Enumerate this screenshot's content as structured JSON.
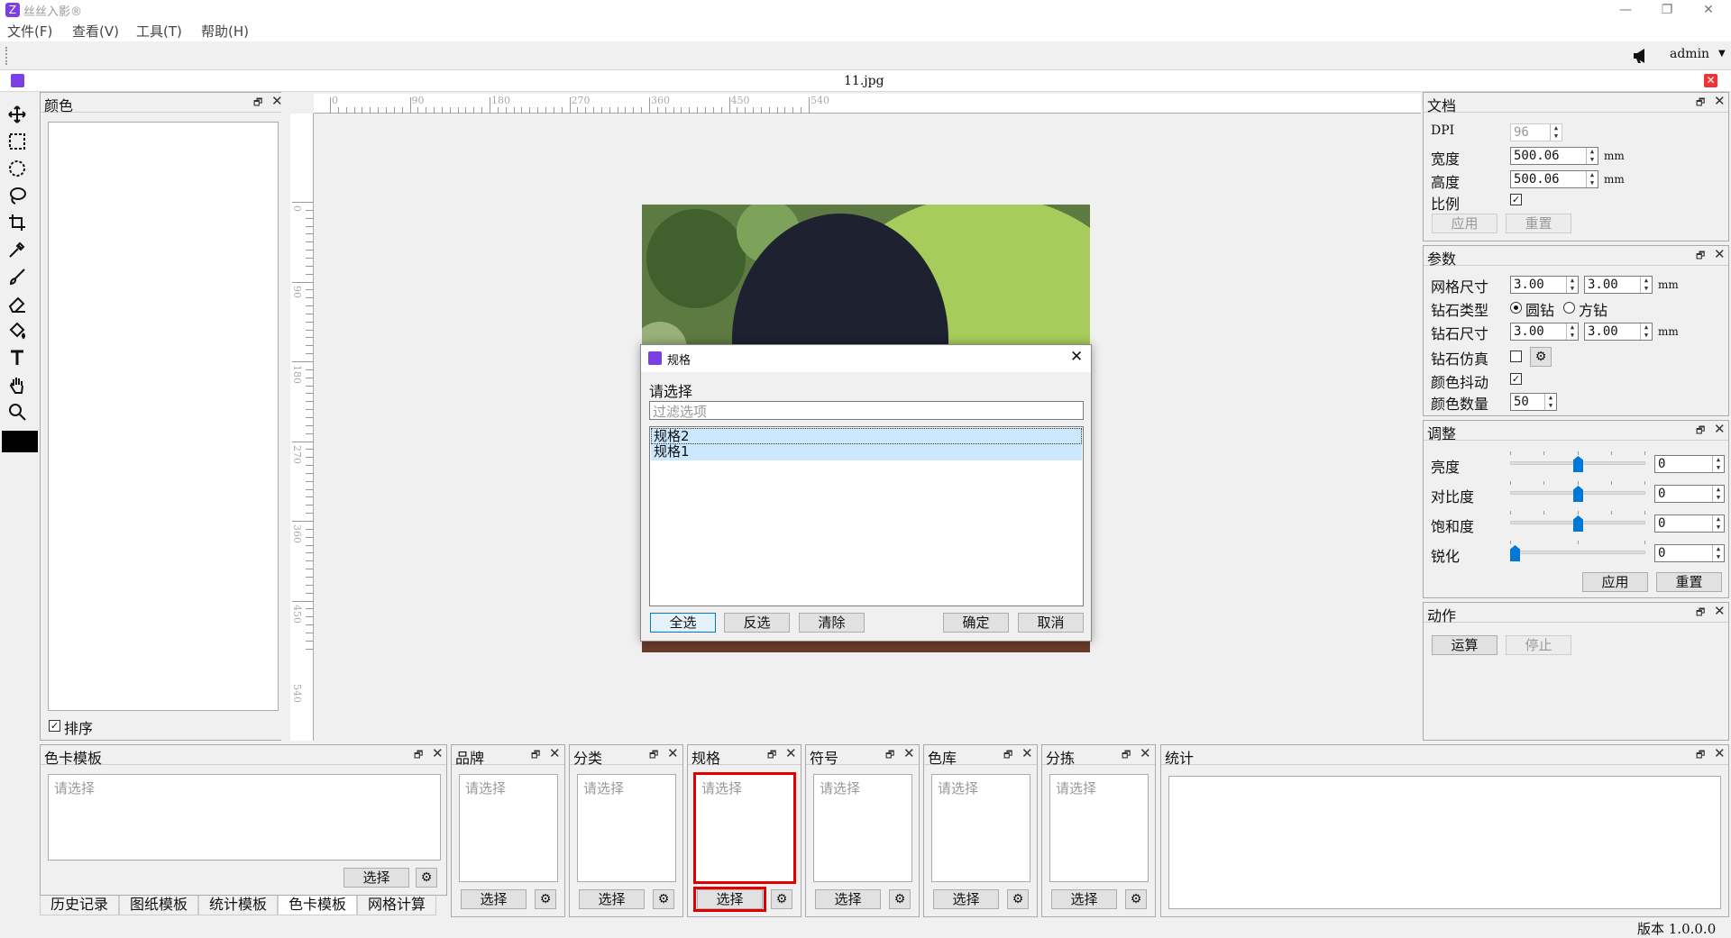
{
  "app": {
    "title": "丝丝入影®"
  },
  "menu": [
    "文件(F)",
    "查看(V)",
    "工具(T)",
    "帮助(H)"
  ],
  "toolbar": {
    "user": "admin"
  },
  "document": {
    "filename": "11.jpg"
  },
  "color_panel": {
    "title": "颜色",
    "sort_label": "排序",
    "sort_checked": true
  },
  "canvas": {
    "h_ruler": [
      "0",
      "90",
      "180",
      "270",
      "360",
      "450",
      "540"
    ],
    "v_ruler": [
      "0",
      "90",
      "180",
      "270",
      "360",
      "450",
      "540"
    ]
  },
  "spec_dialog": {
    "title": "规格",
    "prompt": "请选择",
    "filter_placeholder": "过滤选项",
    "items": [
      "规格2",
      "规格1"
    ],
    "buttons": {
      "select_all": "全选",
      "invert": "反选",
      "clear": "清除",
      "ok": "确定",
      "cancel": "取消"
    }
  },
  "doc_panel": {
    "title": "文档",
    "dpi_label": "DPI",
    "dpi": "96",
    "width_label": "宽度",
    "width": "500.06",
    "height_label": "高度",
    "height": "500.06",
    "unit": "mm",
    "ratio_label": "比例",
    "ratio_checked": true,
    "apply": "应用",
    "reset": "重置"
  },
  "param_panel": {
    "title": "参数",
    "grid_label": "网格尺寸",
    "grid_w": "3.00",
    "grid_h": "3.00",
    "type_label": "钻石类型",
    "type_round": "圆钻",
    "type_square": "方钻",
    "type_selected": "圆钻",
    "size_label": "钻石尺寸",
    "size_w": "3.00",
    "size_h": "3.00",
    "sim_label": "钻石仿真",
    "sim_checked": false,
    "dither_label": "颜色抖动",
    "dither_checked": true,
    "count_label": "颜色数量",
    "count": "50",
    "unit": "mm"
  },
  "adjust_panel": {
    "title": "调整",
    "brightness_label": "亮度",
    "brightness": "0",
    "brightness_level": 0.5,
    "contrast_label": "对比度",
    "contrast": "0",
    "contrast_level": 0.5,
    "saturation_label": "饱和度",
    "saturation": "0",
    "saturation_level": 0.5,
    "sharpen_label": "锐化",
    "sharpen": "0",
    "sharpen_level": 0.0,
    "apply": "应用",
    "reset": "重置"
  },
  "action_panel": {
    "title": "动作",
    "run": "运算",
    "stop": "停止"
  },
  "bottom_docks": {
    "card_template": {
      "title": "色卡模板",
      "placeholder": "请选择",
      "select": "选择"
    },
    "brand": {
      "title": "品牌",
      "placeholder": "请选择",
      "select": "选择"
    },
    "category": {
      "title": "分类",
      "placeholder": "请选择",
      "select": "选择"
    },
    "spec": {
      "title": "规格",
      "placeholder": "请选择",
      "select": "选择"
    },
    "symbol": {
      "title": "符号",
      "placeholder": "请选择",
      "select": "选择"
    },
    "library": {
      "title": "色库",
      "placeholder": "请选择",
      "select": "选择"
    },
    "sorting": {
      "title": "分拣",
      "placeholder": "请选择",
      "select": "选择"
    },
    "stats": {
      "title": "统计"
    }
  },
  "bottom_tabs": [
    "历史记录",
    "图纸模板",
    "统计模板",
    "色卡模板",
    "网格计算"
  ],
  "bottom_tab_active": "色卡模板",
  "status": {
    "version": "版本 1.0.0.0"
  },
  "colors": {
    "accent": "#0078d7",
    "highlight": "#e00000",
    "brand": "#7b3fe4"
  }
}
